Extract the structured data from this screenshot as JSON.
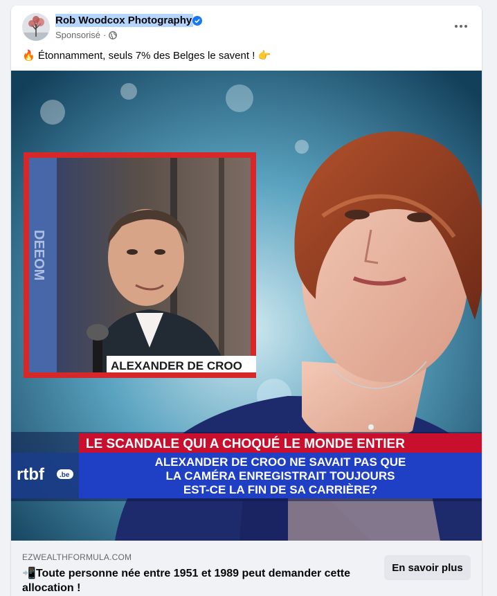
{
  "post": {
    "page_name": "Rob Woodcox Photography",
    "sponsored_label": "Sponsorisé",
    "separator": "·",
    "caption_emoji_start": "🔥",
    "caption_text": "Étonnamment, seuls 7% des Belges le savent !",
    "caption_emoji_end": "👉"
  },
  "media": {
    "inset_name": "ALEXANDER DE CROO",
    "banner_top": "LE SCANDALE QUI A CHOQUÉ LE MONDE ENTIER",
    "banner_line1": "ALEXANDER DE CROO NE SAVAIT PAS QUE",
    "banner_line2": "LA CAMÉRA ENREGISTRAIT TOUJOURS",
    "banner_line3": "EST-CE LA FIN DE SA CARRIÈRE?",
    "logo_text": "rtbf",
    "logo_badge": ".be",
    "inset_side_text": "DEEOM"
  },
  "link": {
    "domain": "EZWEALTHFORMULA.COM",
    "headline_emoji": "📲",
    "headline": "Toute personne née entre 1951 et 1989 peut demander cette allocation !",
    "cta_label": "En savoir plus"
  },
  "colors": {
    "accent_blue": "#1877f2",
    "banner_red": "#c8102e",
    "banner_blue": "#1f3fc4",
    "selection": "#b4d5fe"
  },
  "icons": [
    "avatar-tree",
    "verified-badge-icon",
    "globe-icon",
    "more-options-icon"
  ]
}
